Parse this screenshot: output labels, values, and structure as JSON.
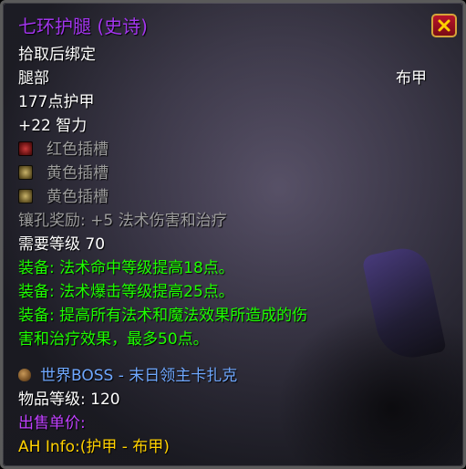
{
  "item": {
    "name": "七环护腿 (史诗)",
    "binding": "拾取后绑定",
    "slot": "腿部",
    "armor_type": "布甲",
    "armor": "177点护甲",
    "stat_intellect": "+22 智力",
    "sockets": [
      {
        "label": "红色插槽",
        "color": "red"
      },
      {
        "label": "黄色插槽",
        "color": "yellow"
      },
      {
        "label": "黄色插槽",
        "color": "yellow"
      }
    ],
    "socket_bonus": "镶孔奖励: +5 法术伤害和治疗",
    "required_level": "需要等级 70",
    "equip_effects": [
      "装备:  法术命中等级提高18点。",
      "装备:  法术爆击等级提高25点。",
      "装备:  提高所有法术和魔法效果所造成的伤",
      "害和治疗效果，最多50点。"
    ],
    "source": "世界BOSS - 末日领主卡扎克",
    "item_level": "物品等级: 120",
    "sell_price": "出售单价:",
    "ah_info": "AH Info:(护甲 - 布甲)"
  },
  "colors": {
    "epic": "#a335ee",
    "white": "#ffffff",
    "gray": "#9d9d9d",
    "green": "#1eff00",
    "source_blue": "#6fa8ff",
    "yellow": "#ffd100"
  },
  "icons": {
    "close": "close-icon",
    "red_socket": "red-socket-icon",
    "yellow_socket": "yellow-socket-icon",
    "source": "money-bag-icon"
  }
}
